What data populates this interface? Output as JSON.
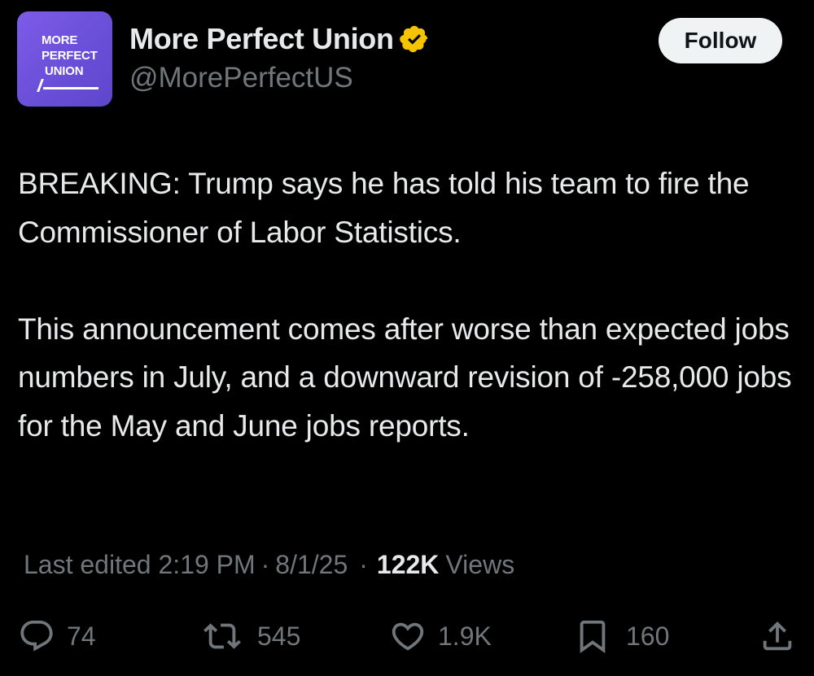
{
  "author": {
    "display_name": "More Perfect Union",
    "handle": "@MorePerfectUS",
    "avatar_lines": [
      "MORE",
      "PERFECT",
      "UNION"
    ],
    "verified": true,
    "verified_badge_color": "#f4c400"
  },
  "follow_button": {
    "label": "Follow"
  },
  "tweet": {
    "paragraphs": [
      "BREAKING: Trump says he has told his team to fire the Commissioner of Labor Statistics.",
      "This announcement comes after worse than expected jobs numbers in July, and a downward revision of -258,000 jobs for the May and June jobs reports."
    ]
  },
  "meta": {
    "edited_label": "Last edited 2:19 PM",
    "separator": "·",
    "date": "8/1/25",
    "views_count": "122K",
    "views_label": "Views"
  },
  "actions": {
    "replies": {
      "icon": "reply-icon",
      "count": "74"
    },
    "reposts": {
      "icon": "repost-icon",
      "count": "545"
    },
    "likes": {
      "icon": "heart-icon",
      "count": "1.9K"
    },
    "bookmarks": {
      "icon": "bookmark-icon",
      "count": "160"
    },
    "share": {
      "icon": "share-icon"
    }
  },
  "colors": {
    "background": "#000000",
    "primary_text": "#e7e9ea",
    "secondary_text": "#71767b",
    "avatar_purple": "#6a4fd8",
    "follow_button_bg": "#eff3f4"
  }
}
